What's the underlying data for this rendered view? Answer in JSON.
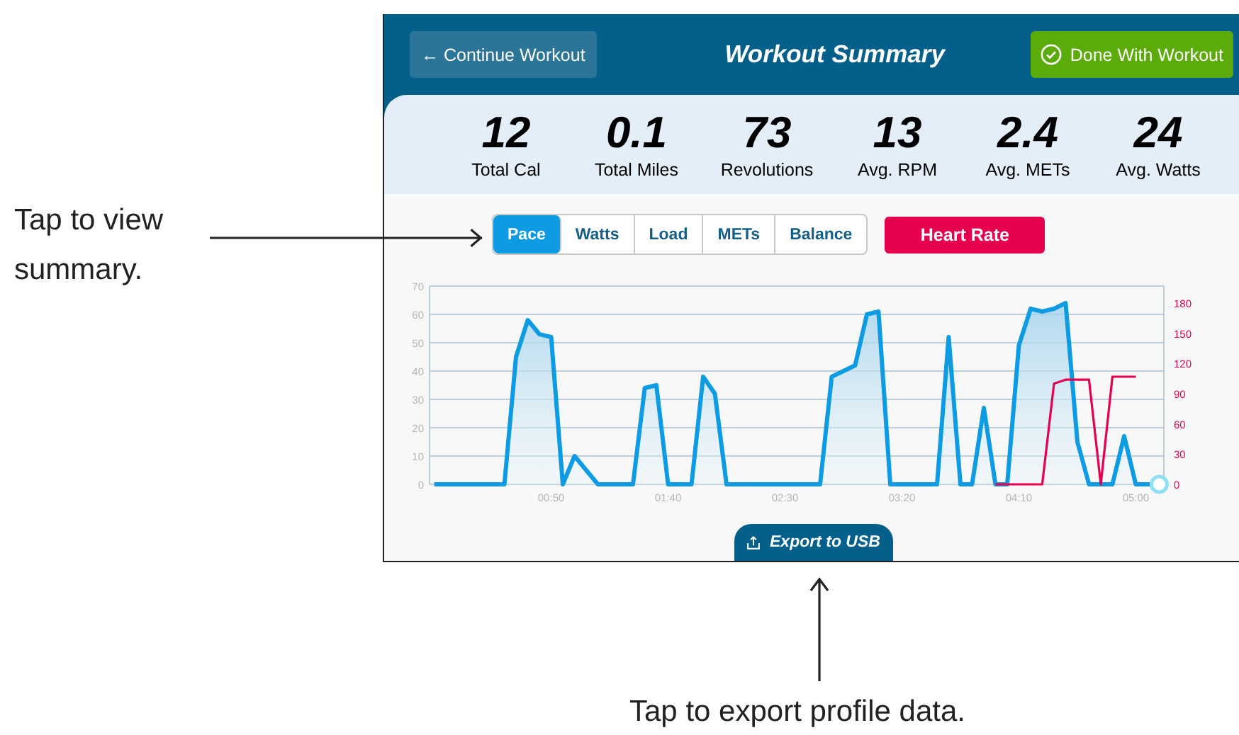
{
  "callouts": [
    {
      "text": "Tap to view summary."
    },
    {
      "text": "Tap to export profile data."
    }
  ],
  "header": {
    "back_button": "← Continue Workout",
    "title": "Workout Summary",
    "done_button": "Done With Workout"
  },
  "stats": [
    {
      "value": "12",
      "label": "Total Cal"
    },
    {
      "value": "0.1",
      "label": "Total Miles"
    },
    {
      "value": "73",
      "label": "Revolutions"
    },
    {
      "value": "13",
      "label": "Avg. RPM"
    },
    {
      "value": "2.4",
      "label": "Avg. METs"
    },
    {
      "value": "24",
      "label": "Avg. Watts"
    }
  ],
  "tabs": [
    {
      "label": "Pace",
      "selected": true
    },
    {
      "label": "Watts",
      "selected": false
    },
    {
      "label": "Load",
      "selected": false
    },
    {
      "label": "METs",
      "selected": false
    },
    {
      "label": "Balance",
      "selected": false
    }
  ],
  "heart_rate_toggle": {
    "label": "Heart Rate",
    "on": true
  },
  "chart": {
    "chart_data": {
      "type": "area",
      "grid": true,
      "x": [
        0,
        5,
        10,
        15,
        20,
        25,
        30,
        35,
        40,
        45,
        50,
        55,
        60,
        65,
        70,
        75,
        80,
        85,
        90,
        95,
        100,
        105,
        110,
        115,
        120,
        125,
        130,
        135,
        140,
        145,
        150,
        155,
        160,
        165,
        170,
        175,
        180,
        185,
        190,
        195,
        200,
        205,
        210,
        215,
        220,
        225,
        230,
        235,
        240,
        245,
        250,
        255,
        260,
        265,
        270,
        275,
        280,
        285,
        290,
        295,
        300,
        305,
        310
      ],
      "series": [
        {
          "color": "#0d9be3",
          "values": [
            0,
            0,
            0,
            0,
            0,
            0,
            0,
            45,
            58,
            53,
            52,
            0,
            10,
            5,
            0,
            0,
            0,
            0,
            34,
            35,
            0,
            0,
            0,
            38,
            32,
            0,
            0,
            0,
            0,
            0,
            0,
            0,
            0,
            0,
            38,
            40,
            42,
            60,
            61,
            0,
            0,
            0,
            0,
            0,
            52,
            0,
            0,
            27,
            0,
            0,
            49,
            62,
            61,
            62,
            64,
            15,
            0,
            0,
            0,
            17,
            0,
            0,
            0
          ]
        }
      ],
      "xlim": [
        -2,
        312
      ],
      "ylim": [
        0,
        70
      ],
      "xticks": [
        {
          "value": 50,
          "label": "00:50"
        },
        {
          "value": 100,
          "label": "01:40"
        },
        {
          "value": 150,
          "label": "02:30"
        },
        {
          "value": 200,
          "label": "03:20"
        },
        {
          "value": 250,
          "label": "04:10"
        },
        {
          "value": 300,
          "label": "05:00"
        }
      ],
      "yticks": [
        0,
        10,
        20,
        30,
        40,
        50,
        60,
        70
      ]
    }
  },
  "heart_rate_overlay": {
    "chart_data": {
      "type": "line",
      "x": [
        240,
        245,
        250,
        255,
        260,
        265,
        270,
        275,
        280,
        285,
        290,
        295,
        300
      ],
      "series": [
        {
          "color": "#e6004f",
          "values": [
            0,
            0,
            0,
            0,
            0,
            100,
            104,
            104,
            104,
            0,
            107,
            107,
            107
          ]
        }
      ],
      "xlim": [
        -2,
        312
      ],
      "ylim": [
        0,
        197
      ],
      "yticks": [
        0,
        30,
        60,
        90,
        120,
        150,
        180
      ]
    }
  },
  "export_button": "Export to USB"
}
